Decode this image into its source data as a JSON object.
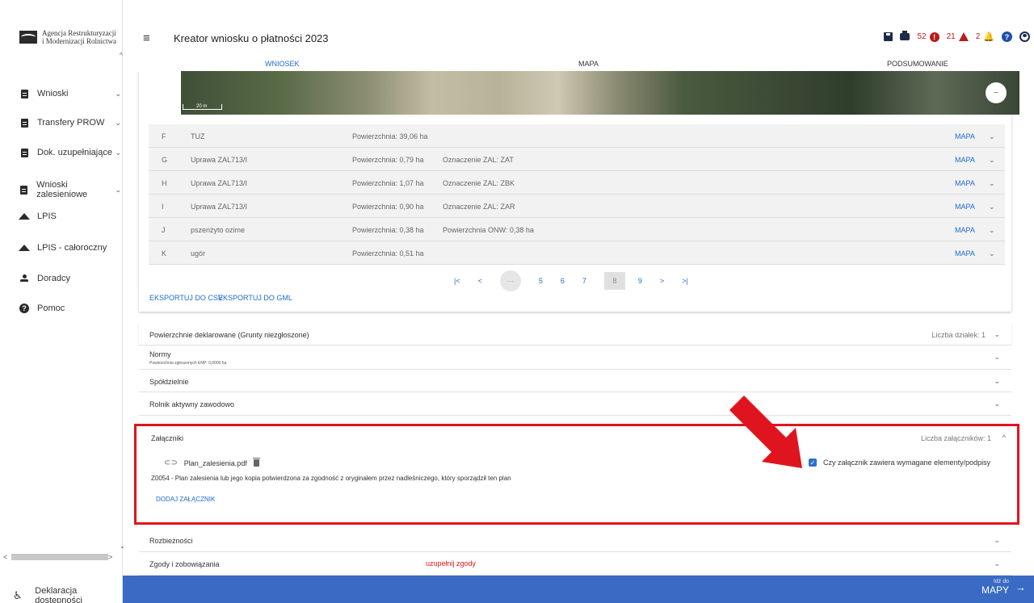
{
  "logo": {
    "line1": "Agencja Restrukturyzacji",
    "line2": "i Modernizacji Rolnictwa"
  },
  "sidebar": {
    "items": [
      {
        "label": "Wnioski",
        "icon": "document-icon",
        "has_chevron": true
      },
      {
        "label": "Transfery PROW",
        "icon": "document-icon",
        "has_chevron": true
      },
      {
        "label": "Dok. uzupełniające",
        "icon": "document-icon",
        "has_chevron": true
      },
      {
        "label": "Wnioski zalesieniowe",
        "icon": "document-icon",
        "has_chevron": true
      },
      {
        "label": "LPIS",
        "icon": "mountain-icon",
        "has_chevron": false
      },
      {
        "label": "LPIS - całoroczny",
        "icon": "mountain-icon",
        "has_chevron": false
      },
      {
        "label": "Doradcy",
        "icon": "user-icon",
        "has_chevron": false
      },
      {
        "label": "Pomoc",
        "icon": "help-icon",
        "has_chevron": false
      }
    ],
    "accessibility": "Deklaracja dostępności"
  },
  "header": {
    "title": "Kreator wniosku o płatności 2023",
    "errors_count": "52",
    "warnings_count": "21",
    "notifications_count": "2"
  },
  "tabs": [
    {
      "label": "WNIOSEK",
      "active": true
    },
    {
      "label": "MAPA",
      "active": false
    },
    {
      "label": "PODSUMOWANIE",
      "active": false
    }
  ],
  "map_scale": "20 m",
  "parcels": [
    {
      "id": "F",
      "crop": "TUZ",
      "area": "Powierzchnia: 39,06 ha",
      "extra": "",
      "map": "MAPA"
    },
    {
      "id": "G",
      "crop": "Uprawa ZAL713/I",
      "area": "Powierzchnia: 0,79 ha",
      "extra": "Oznaczenie ZAL: ZAT",
      "map": "MAPA"
    },
    {
      "id": "H",
      "crop": "Uprawa ZAL713/I",
      "area": "Powierzchnia: 1,07 ha",
      "extra": "Oznaczenie ZAL: ZBK",
      "map": "MAPA"
    },
    {
      "id": "I",
      "crop": "Uprawa ZAL713/I",
      "area": "Powierzchnia: 0,90 ha",
      "extra": "Oznaczenie ZAL: ZAR",
      "map": "MAPA"
    },
    {
      "id": "J",
      "crop": "pszenżyto ozime",
      "area": "Powierzchnia: 0,38 ha",
      "extra": "Powierzchnia ONW: 0,38 ha",
      "map": "MAPA"
    },
    {
      "id": "K",
      "crop": "ugór",
      "area": "Powierzchnia: 0,51 ha",
      "extra": "",
      "map": "MAPA"
    }
  ],
  "pager": {
    "first": "|<",
    "prev": "<",
    "dots": "···",
    "pages": [
      "5",
      "6",
      "7"
    ],
    "current": "8",
    "next_page": "9",
    "next": ">",
    "last": ">|"
  },
  "export": {
    "csv": "EKSPORTUJ DO CSV",
    "gml": "EKSPORTUJ DO GML"
  },
  "sections": {
    "declared": {
      "label": "Powierzchnie deklarowane (Grunty niezgłoszone)",
      "count": "Liczba działek: 1"
    },
    "norms": {
      "label": "Normy",
      "sub": "Powierzchnia zgłoszonych ENP: 0,0000 ha"
    },
    "coops": {
      "label": "Spółdzielnie"
    },
    "active_farmer": {
      "label": "Rolnik aktywny zawodowo"
    },
    "attachments": {
      "label": "Załączniki",
      "count": "Liczba załączników: 1",
      "file_name": "Plan_zalesienia.pdf",
      "description": "Z0054 - Plan zalesienia lub jego kopia potwierdzona za zgodność z oryginałem przez nadleśniczego, który sporządził ten plan",
      "checkbox_label": "Czy załącznik zawiera wymagane elementy/podpisy",
      "checkbox_checked": true,
      "add_label": "DODAJ ZAŁĄCZNIK"
    },
    "discrepancies": {
      "label": "Rozbieżności"
    },
    "consents": {
      "label": "Zgody i zobowiązania",
      "warning": "uzupełnij zgody"
    }
  },
  "bottom": {
    "goto_small": "Idź do",
    "goto_big": "MAPY"
  },
  "colors": {
    "accent": "#1e6bd0",
    "bottom_bar": "#3a6bc4",
    "highlight": "#e0141e",
    "error": "#b71c1c"
  }
}
